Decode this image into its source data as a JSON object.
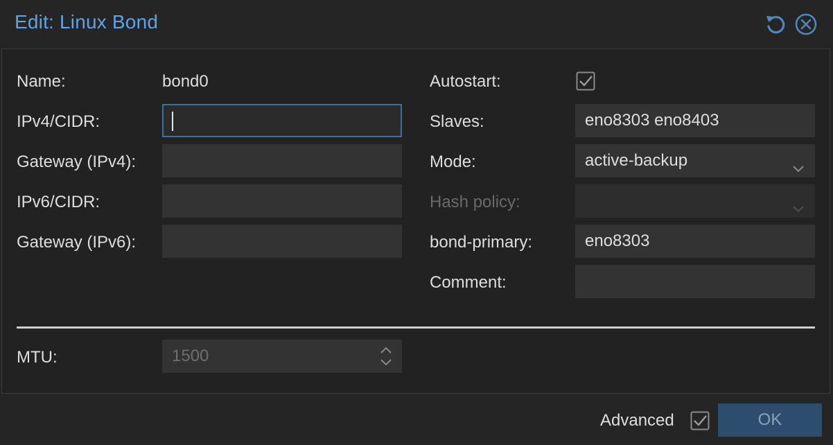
{
  "window": {
    "title": "Edit: Linux Bond",
    "reset_icon": "reset-icon",
    "close_icon": "close-icon"
  },
  "form": {
    "name_label": "Name:",
    "name_value": "bond0",
    "ipv4_label": "IPv4/CIDR:",
    "ipv4_value": "",
    "gateway_ipv4_label": "Gateway (IPv4):",
    "gateway_ipv4_value": "",
    "ipv6_label": "IPv6/CIDR:",
    "ipv6_value": "",
    "gateway_ipv6_label": "Gateway (IPv6):",
    "gateway_ipv6_value": "",
    "autostart_label": "Autostart:",
    "autostart_checked": true,
    "slaves_label": "Slaves:",
    "slaves_value": "eno8303 eno8403",
    "mode_label": "Mode:",
    "mode_value": "active-backup",
    "hash_policy_label": "Hash policy:",
    "hash_policy_value": "",
    "bond_primary_label": "bond-primary:",
    "bond_primary_value": "eno8303",
    "comment_label": "Comment:",
    "comment_value": "",
    "mtu_label": "MTU:",
    "mtu_placeholder": "1500"
  },
  "footer": {
    "advanced_label": "Advanced",
    "advanced_checked": true,
    "ok_label": "OK"
  },
  "colors": {
    "title": "#5da3e6",
    "accent_border": "#3d6fa3",
    "ok_button_bg": "#2d4d6e"
  }
}
